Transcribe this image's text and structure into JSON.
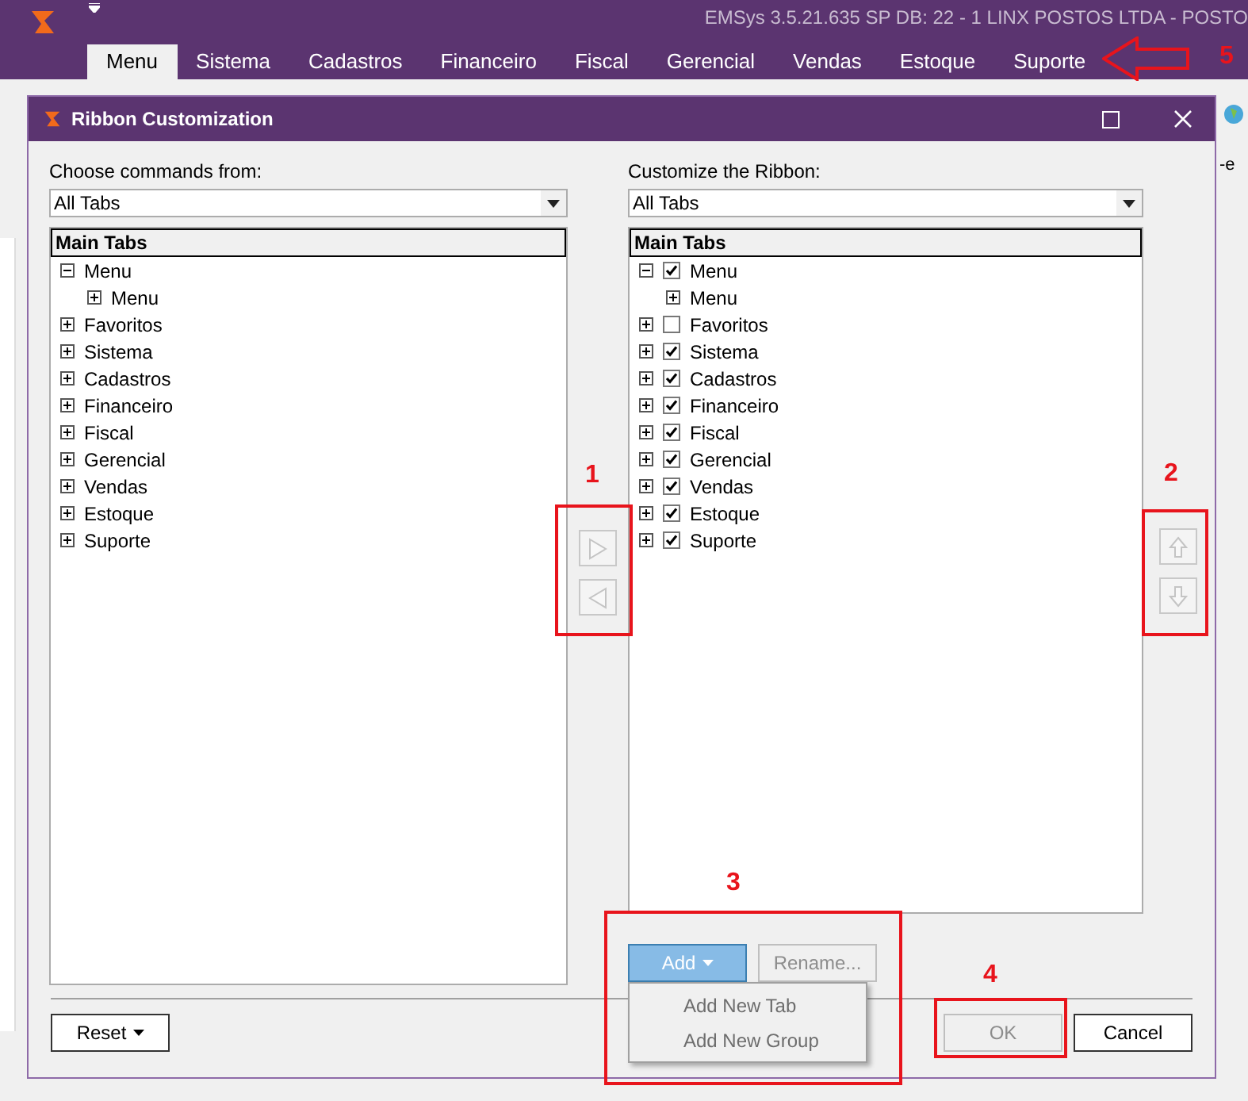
{
  "app": {
    "title": "EMSys 3.5.21.635 SP DB: 22 - 1 LINX POSTOS LTDA - POSTO",
    "tabs": [
      {
        "label": "Menu",
        "selected": true
      },
      {
        "label": "Sistema",
        "selected": false
      },
      {
        "label": "Cadastros",
        "selected": false
      },
      {
        "label": "Financeiro",
        "selected": false
      },
      {
        "label": "Fiscal",
        "selected": false
      },
      {
        "label": "Gerencial",
        "selected": false
      },
      {
        "label": "Vendas",
        "selected": false
      },
      {
        "label": "Estoque",
        "selected": false
      },
      {
        "label": "Suporte",
        "selected": false
      }
    ],
    "background_text": "-e"
  },
  "dialog": {
    "title": "Ribbon Customization",
    "left": {
      "label": "Choose commands from:",
      "dropdown": "All Tabs",
      "tree_header": "Main Tabs",
      "items": [
        {
          "label": "Menu",
          "expanded": true,
          "children": [
            {
              "label": "Menu",
              "expanded": false
            }
          ]
        },
        {
          "label": "Favoritos",
          "expanded": false
        },
        {
          "label": "Sistema",
          "expanded": false
        },
        {
          "label": "Cadastros",
          "expanded": false
        },
        {
          "label": "Financeiro",
          "expanded": false
        },
        {
          "label": "Fiscal",
          "expanded": false
        },
        {
          "label": "Gerencial",
          "expanded": false
        },
        {
          "label": "Vendas",
          "expanded": false
        },
        {
          "label": "Estoque",
          "expanded": false
        },
        {
          "label": "Suporte",
          "expanded": false
        }
      ]
    },
    "move_buttons": {
      "disabled": true
    },
    "order_buttons": {
      "disabled": true
    },
    "right": {
      "label": "Customize the Ribbon:",
      "dropdown": "All Tabs",
      "tree_header": "Main Tabs",
      "items": [
        {
          "label": "Menu",
          "expanded": true,
          "checked": true,
          "children": [
            {
              "label": "Menu",
              "expanded": false
            }
          ]
        },
        {
          "label": "Favoritos",
          "expanded": false,
          "checked": false
        },
        {
          "label": "Sistema",
          "expanded": false,
          "checked": true
        },
        {
          "label": "Cadastros",
          "expanded": false,
          "checked": true
        },
        {
          "label": "Financeiro",
          "expanded": false,
          "checked": true
        },
        {
          "label": "Fiscal",
          "expanded": false,
          "checked": true
        },
        {
          "label": "Gerencial",
          "expanded": false,
          "checked": true
        },
        {
          "label": "Vendas",
          "expanded": false,
          "checked": true
        },
        {
          "label": "Estoque",
          "expanded": false,
          "checked": true
        },
        {
          "label": "Suporte",
          "expanded": false,
          "checked": true
        }
      ]
    },
    "add_button": {
      "label": "Add",
      "selected": true
    },
    "rename_button": {
      "label": "Rename...",
      "disabled": true
    },
    "add_menu": [
      "Add New Tab",
      "Add New Group"
    ],
    "reset_button": {
      "label": "Reset",
      "disabled": false
    },
    "ok_button": {
      "label": "OK",
      "disabled": true
    },
    "cancel_button": {
      "label": "Cancel",
      "disabled": false
    }
  },
  "annotations": [
    {
      "label": "1"
    },
    {
      "label": "2"
    },
    {
      "label": "3"
    },
    {
      "label": "4"
    },
    {
      "label": "5"
    }
  ]
}
